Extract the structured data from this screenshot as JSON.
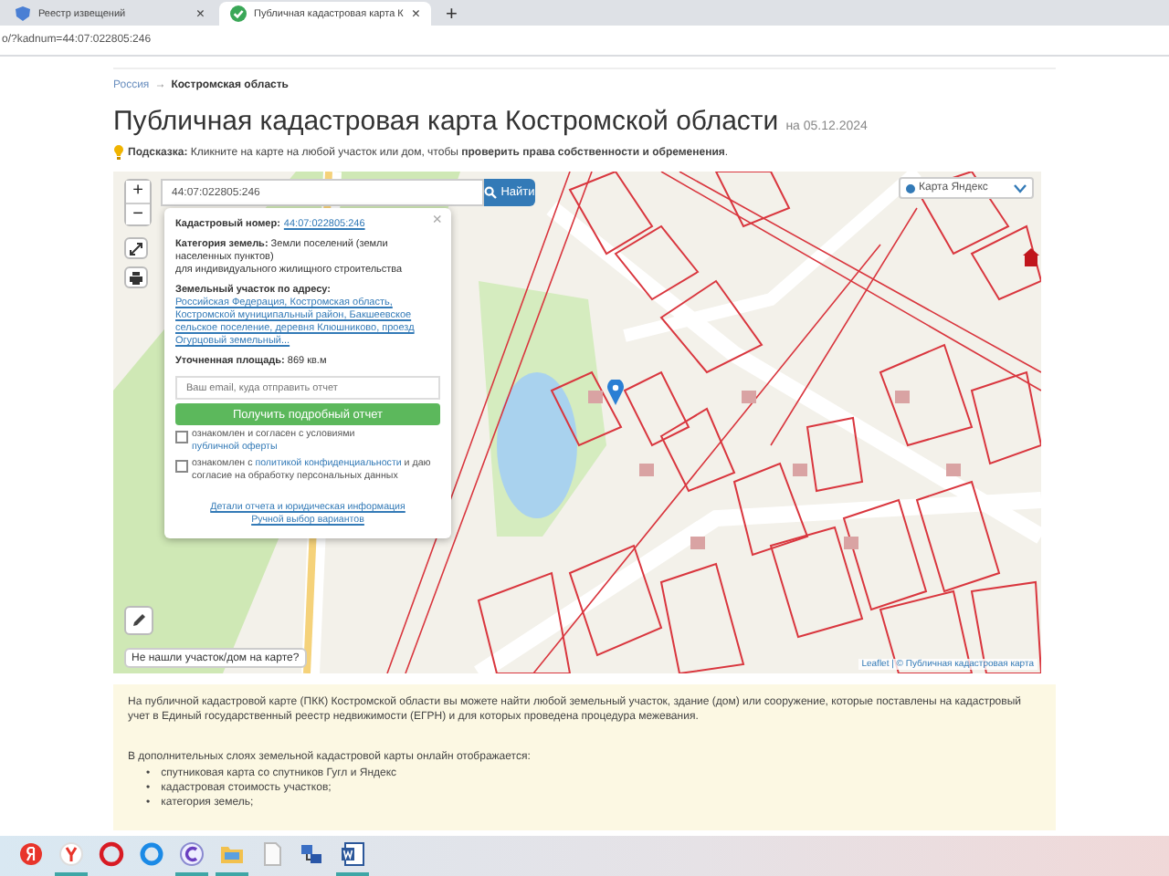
{
  "browser": {
    "tabs": [
      {
        "title": "Реестр извещений",
        "close": "×",
        "selected": false,
        "kind": "shield"
      },
      {
        "title": "Публичная кадастровая карта К",
        "close": "×",
        "selected": true,
        "kind": "check"
      }
    ],
    "new_tab": "+",
    "url": "o/?kadnum=44:07:022805:246"
  },
  "breadcrumb": {
    "items": [
      "Россия",
      "Костромская область"
    ],
    "separator": "→"
  },
  "title": "Публичная кадастровая карта Костромской области",
  "date": "на 05.12.2024",
  "hint": "**Подсказка:** Кликните на карте на любой участок или дом, чтобы **проверить права собственности и обременения**.",
  "map": {
    "search": {
      "value": "44:07:022805:246",
      "button": "Найти"
    },
    "zoom_in": "+",
    "zoom_out": "−",
    "layer": {
      "label": "Карта Яндекс",
      "selected": true
    },
    "popup": {
      "close": "×",
      "cadastral_label": "Кадастровый номер:",
      "cadastral_number": "44:07:022805:246",
      "category": "**Категория земель:** Земли поселений (земли населенных пунктов)",
      "use": "для индивидуального жилищного строительства",
      "address_label": "Земельный участок по адресу:",
      "address": "Российская Федерация, Костромская область, Костромской муниципальный район, Бакшеевское сельское поселение, деревня Клюшниково, проезд Огурцовый земельный...",
      "area": "**Уточненная площадь:** 869 кв.м",
      "email_placeholder": "Ваш email, куда отправить отчет",
      "report_button": "Получить подробный отчет",
      "consents": [
        {
          "text": "ознакомлен и согласен с условиями",
          "link": "публичной оферты",
          "checked": false
        },
        {
          "text": "ознакомлен с",
          "link": "политикой конфиденциальности",
          "after": "и даю согласие на обработку персональных данных",
          "checked": false
        }
      ],
      "links": [
        "Детали отчета и юридическая информация",
        "Ручной выбор вариантов"
      ]
    },
    "not_found": "Не нашли участок/дом на карте?",
    "attribution": "Leaflet | © Публичная кадастровая карта"
  },
  "info": {
    "paragraph": "На публичной кадастровой карте (ПКК) Костромской области вы можете найти любой земельный участок, здание (дом) или сооружение, которые поставлены на кадастровый учет в Единый государственный реестр недвижимости (ЕГРН) и для которых проведена процедура межевания.",
    "list_title": "В дополнительных слоях земельной кадастровой карты онлайн отображается:",
    "bullet": "•",
    "items": [
      "спутниковая карта со спутников Гугл и Яндекс",
      "кадастровая стоимость участков;",
      "категория земель;"
    ]
  },
  "taskbar": {
    "apps": [
      {
        "kind": "letter-circle",
        "running": false
      },
      {
        "kind": "browser",
        "running": true
      },
      {
        "kind": "opera",
        "running": false
      },
      {
        "kind": "ring",
        "running": false
      },
      {
        "kind": "c-circle",
        "running": true
      },
      {
        "kind": "folder",
        "running": true
      },
      {
        "kind": "document",
        "running": false
      },
      {
        "kind": "network",
        "running": false
      },
      {
        "kind": "word",
        "running": true
      }
    ]
  }
}
